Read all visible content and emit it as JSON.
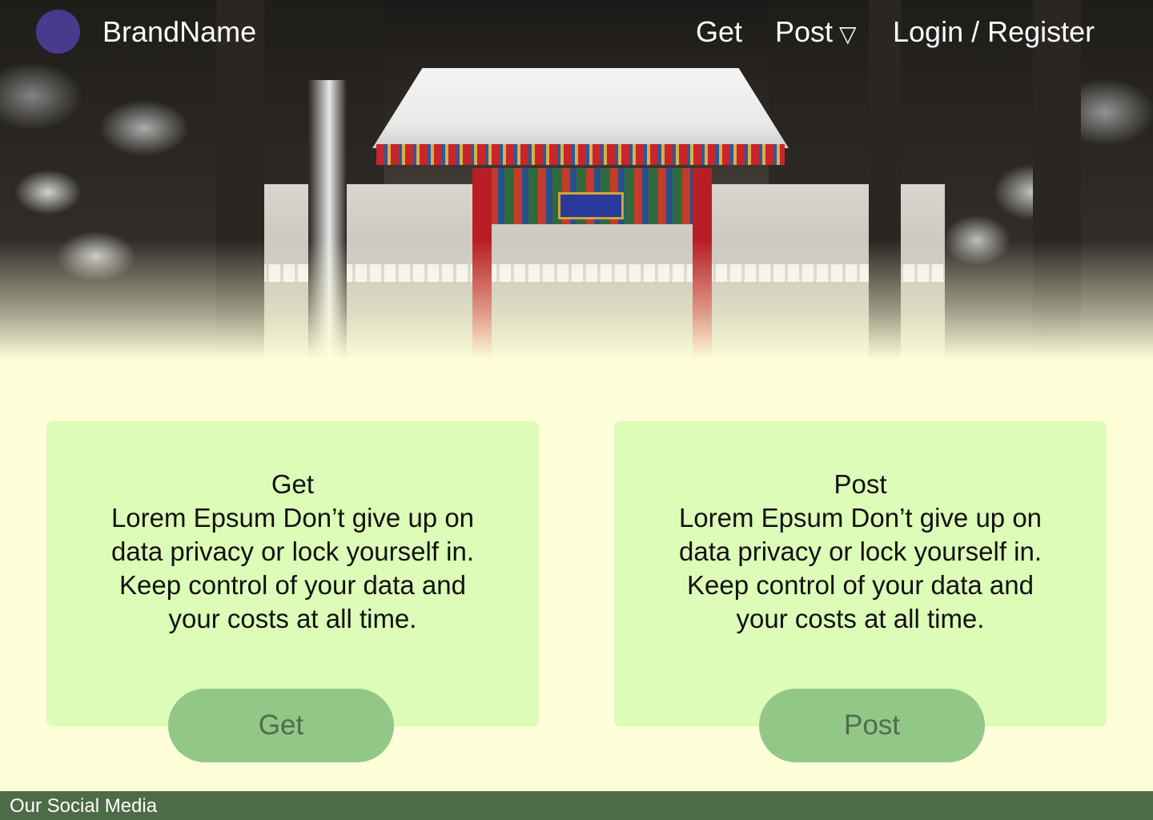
{
  "nav": {
    "brand": "BrandName",
    "links": [
      {
        "label": "Get"
      },
      {
        "label": "Post"
      },
      {
        "label": "Login / Register"
      }
    ],
    "dropdown_caret": "▽"
  },
  "cards": [
    {
      "title": "Get",
      "body": "Lorem Epsum Don’t give up on data privacy or lock yourself in. Keep control of your data and your costs at all time.",
      "button": "Get"
    },
    {
      "title": "Post",
      "body": "Lorem Epsum Don’t give up on data privacy or lock yourself in. Keep control of your data and your costs at all time.",
      "button": "Post"
    }
  ],
  "footer": {
    "label": "Our Social Media"
  },
  "colors": {
    "background": "#fefed9",
    "card": "#dcfcb8",
    "button": "#92c787",
    "button_text": "#4f6e49",
    "footer": "#4e6b47",
    "logo": "#4a3a8e"
  }
}
